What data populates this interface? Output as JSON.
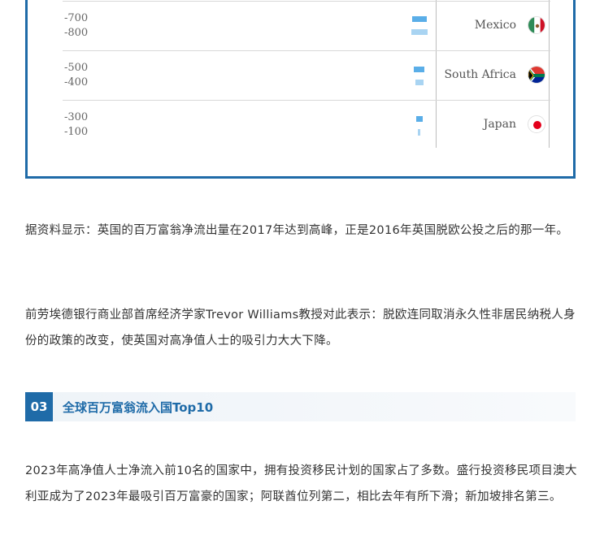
{
  "chart": {
    "rows": [
      {
        "country": "Mexico",
        "values": [
          "-700",
          "-800"
        ],
        "flag": "mexico-flag-icon",
        "bars": [
          {
            "value": -700,
            "shade": "dark"
          },
          {
            "value": -800,
            "shade": "light"
          }
        ]
      },
      {
        "country": "South Africa",
        "values": [
          "-500",
          "-400"
        ],
        "flag": "south-africa-flag-icon",
        "bars": [
          {
            "value": -500,
            "shade": "dark"
          },
          {
            "value": -400,
            "shade": "light"
          }
        ]
      },
      {
        "country": "Japan",
        "values": [
          "-300",
          "-100"
        ],
        "flag": "japan-flag-icon",
        "bars": [
          {
            "value": -300,
            "shade": "dark"
          },
          {
            "value": -100,
            "shade": "light"
          }
        ]
      }
    ],
    "colors": {
      "frame": "#1f6ba8",
      "bar_dark": "#5aaee8",
      "bar_light": "#a9d4f2"
    }
  },
  "paragraphs": {
    "p1": "据资料显示：英国的百万富翁净流出量在2017年达到高峰，正是2016年英国脱欧公投之后的那一年。",
    "p2": "前劳埃德银行商业部首席经济学家Trevor Williams教授对此表示：脱欧连同取消永久性非居民纳税人身份的政策的改变，使英国对高净值人士的吸引力大大下降。",
    "p3": "2023年高净值人士净流入前10名的国家中，拥有投资移民计划的国家占了多数。盛行投资移民项目澳大利亚成为了2023年最吸引百万富豪的国家；阿联酋位列第二，相比去年有所下滑；新加坡排名第三。"
  },
  "section": {
    "number": "03",
    "title": "全球百万富翁流入国Top10"
  }
}
